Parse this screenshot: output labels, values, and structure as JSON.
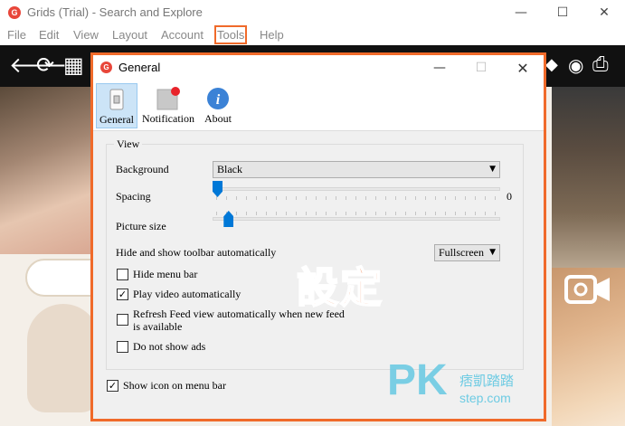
{
  "app": {
    "title": "Grids (Trial) - Search and Explore",
    "logo_letter": "G",
    "controls": {
      "minimize": "—",
      "maximize": "☐",
      "close": "✕"
    }
  },
  "menu": [
    {
      "label": "File"
    },
    {
      "label": "Edit"
    },
    {
      "label": "View"
    },
    {
      "label": "Layout"
    },
    {
      "label": "Account"
    },
    {
      "label": "Tools"
    },
    {
      "label": "Help"
    }
  ],
  "toolbar_icons": {
    "back": "🡐",
    "refresh": "⟳",
    "grid": "▦",
    "tag": "◆",
    "speech": "◉",
    "inbox": "⎙"
  },
  "dialog": {
    "title": "General",
    "logo_letter": "G",
    "controls": {
      "minimize": "—",
      "maximize": "☐",
      "close": "✕"
    },
    "tabs": [
      {
        "label": "General",
        "active": true
      },
      {
        "label": "Notification",
        "active": false
      },
      {
        "label": "About",
        "active": false
      }
    ],
    "group_title": "View",
    "background_label": "Background",
    "background_value": "Black",
    "spacing_label": "Spacing",
    "spacing_value": "0",
    "spacing_level": 0,
    "picture_size_label": "Picture size",
    "picture_size_level": 0.04,
    "toolbar_auto_label": "Hide and show toolbar automatically",
    "toolbar_auto_value": "Fullscreen",
    "options": [
      {
        "label": "Hide menu bar",
        "checked": false
      },
      {
        "label": "Play video automatically",
        "checked": true
      },
      {
        "label_line1": "Refresh Feed view automatically when new feed",
        "label_line2": "is available",
        "checked": false
      },
      {
        "label": "Do not show ads",
        "checked": false
      }
    ],
    "show_icon_label": "Show icon on menu bar",
    "show_icon_checked": true
  },
  "overlay": {
    "caption": "設定",
    "watermark_pk": "PK",
    "watermark_cn": "痞凱踏踏",
    "watermark_step": "step.com"
  },
  "colors": {
    "accent": "#f06a2a",
    "slider": "#0078d7",
    "active_tab_bg": "#cce4f7",
    "watermark": "#6ecbe3"
  }
}
